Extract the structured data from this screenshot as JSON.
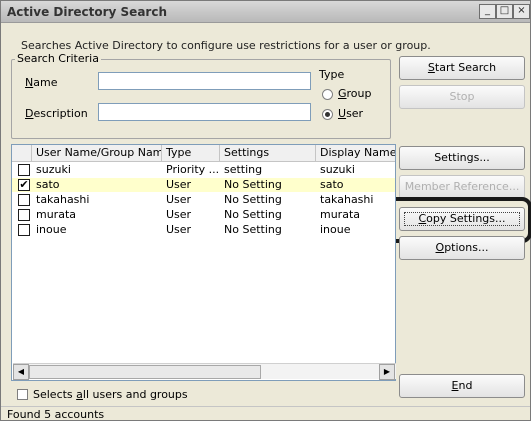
{
  "window": {
    "title": "Active Directory Search",
    "controls": [
      "_",
      "□",
      "×"
    ]
  },
  "description": "Searches Active Directory to configure use restrictions for a user or group.",
  "search_criteria": {
    "legend": "Search Criteria",
    "name_label_u": "N",
    "name_label_rest": "ame",
    "name_value": "",
    "desc_label_u": "D",
    "desc_label_rest": "escription",
    "desc_value": "",
    "type_label": "Type",
    "type_options": [
      {
        "u": "G",
        "rest": "roup",
        "checked": false
      },
      {
        "u": "U",
        "rest": "ser",
        "checked": true
      }
    ]
  },
  "buttons": {
    "start_search": {
      "u": "S",
      "rest": "tart Search"
    },
    "stop": "Stop",
    "settings": {
      "pre": "Settings",
      "u": "",
      "rest": "..."
    },
    "member_reference": "Member Reference...",
    "copy_settings": {
      "u": "C",
      "rest": "opy Settings..."
    },
    "options": {
      "u": "O",
      "rest": "ptions..."
    },
    "end": {
      "u": "E",
      "rest": "nd"
    }
  },
  "list": {
    "columns": [
      "User Name/Group Name",
      "Type",
      "Settings",
      "Display Name"
    ],
    "rows": [
      {
        "name": "suzuki",
        "type": "Priority ...",
        "settings": "setting",
        "display": "suzuki",
        "checked": false
      },
      {
        "name": "sato",
        "type": "User",
        "settings": "No Setting",
        "display": "sato",
        "checked": true
      },
      {
        "name": "takahashi",
        "type": "User",
        "settings": "No Setting",
        "display": "takahashi",
        "checked": false
      },
      {
        "name": "murata",
        "type": "User",
        "settings": "No Setting",
        "display": "murata",
        "checked": false
      },
      {
        "name": "inoue",
        "type": "User",
        "settings": "No Setting",
        "display": "inoue",
        "checked": false
      }
    ]
  },
  "select_all": {
    "pre": "Selects ",
    "u": "a",
    "rest": "ll users and groups"
  },
  "status": "Found 5 accounts"
}
